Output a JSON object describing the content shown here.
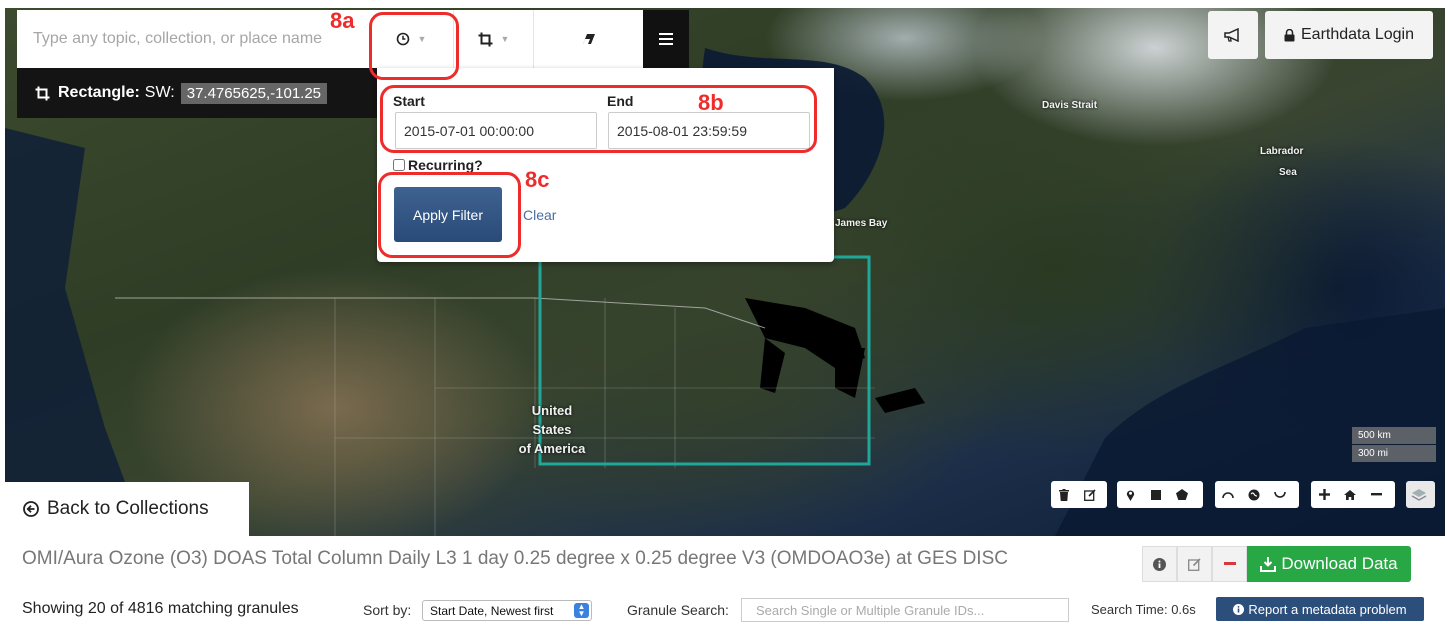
{
  "search": {
    "placeholder": "Type any topic, collection, or place name"
  },
  "toolbar": {
    "time_icon": "clock-icon",
    "spatial_icon": "crop-icon",
    "eraser_icon": "eraser-icon",
    "menu_icon": "hamburger-icon"
  },
  "spatial": {
    "label": "Rectangle:",
    "sw_label": "SW:",
    "sw_value": "37.4765625,-101.25"
  },
  "temporal": {
    "start_label": "Start",
    "start_value": "2015-07-01 00:00:00",
    "end_label": "End",
    "end_value": "2015-08-01 23:59:59",
    "recurring_label": "Recurring?",
    "recurring_checked": false,
    "apply_label": "Apply Filter",
    "clear_label": "Clear"
  },
  "annotations": {
    "a": "8a",
    "b": "8b",
    "c": "8c"
  },
  "header": {
    "login_label": "Earthdata Login",
    "announce_icon": "bullhorn-icon"
  },
  "map": {
    "labels": {
      "davis_strait": "Davis Strait",
      "labrador_sea_1": "Labrador",
      "labrador_sea_2": "Sea",
      "james_bay": "James Bay",
      "usa_1": "United",
      "usa_2": "States",
      "usa_3": "of America"
    },
    "scale_km": "500 km",
    "scale_mi": "300 mi",
    "box_color": "#1fa89a"
  },
  "panel": {
    "back_label": "Back to Collections",
    "collection_title": "OMI/Aura Ozone (O3) DOAS Total Column Daily L3 1 day 0.25 degree x 0.25 degree V3 (OMDOAO3e) at GES DISC",
    "download_label": "Download Data",
    "showing_text": "Showing 20 of 4816 matching granules",
    "sort_label": "Sort by:",
    "sort_value": "Start Date, Newest first",
    "granule_search_label": "Granule Search:",
    "granule_search_placeholder": "Search Single or Multiple Granule IDs...",
    "search_time": "Search Time: 0.6s",
    "report_label": "Report a metadata problem"
  },
  "colors": {
    "accent": "#2c4e7a",
    "download": "#27a844",
    "annotation": "#ee2c2c"
  }
}
